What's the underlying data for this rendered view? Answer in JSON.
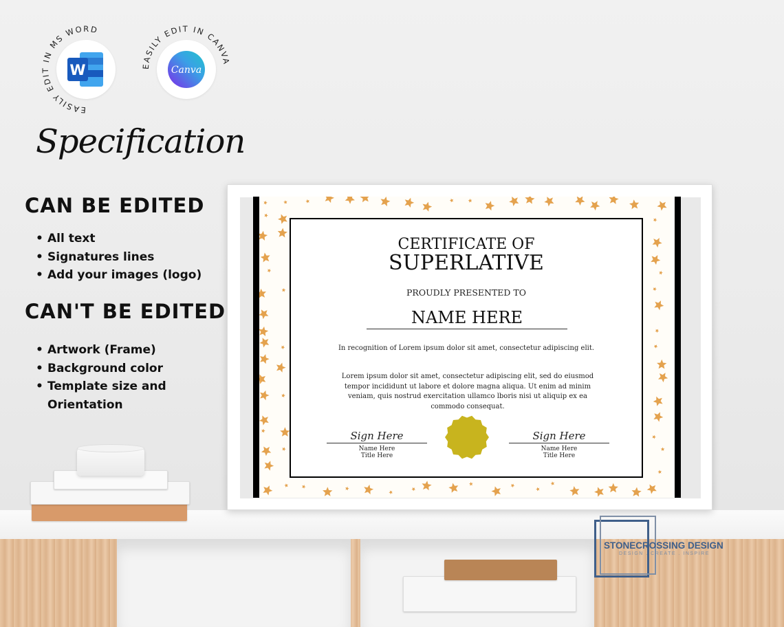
{
  "badges": [
    {
      "ring_text": "EASILY EDIT IN MS WORD",
      "icon": "ms-word-icon",
      "icon_letter": "W",
      "color": "#185abd"
    },
    {
      "ring_text": "EASILY EDIT IN CANVA",
      "icon": "canva-icon",
      "icon_letter": "Canva",
      "color": "#7d2ae8"
    }
  ],
  "spec": {
    "title": "Specification",
    "can_heading": "CAN BE EDITED",
    "can_items": [
      "All text",
      "Signatures lines",
      "Add your images (logo)"
    ],
    "cant_heading": "CAN'T BE EDITED",
    "cant_items": [
      "Artwork (Frame)",
      "Background color",
      "Template size and",
      "Orientation"
    ]
  },
  "certificate": {
    "title_line1": "CERTIFICATE OF",
    "title_line2": "SUPERLATIVE",
    "presented": "PROUDLY PRESENTED TO",
    "name": "NAME HERE",
    "recognition": "In recognition of Lorem ipsum dolor sit amet, consectetur adipiscing elit.",
    "body": "Lorem ipsum dolor sit amet, consectetur adipiscing elit, sed do eiusmod tempor incididunt ut labore et dolore magna aliqua. Ut enim ad minim veniam, quis nostrud exercitation ullamco lboris nisi ut aliquip ex ea commodo consequat.",
    "signatures": [
      {
        "sign": "Sign Here",
        "name": "Name Here",
        "title": "Title Here"
      },
      {
        "sign": "Sign Here",
        "name": "Name Here",
        "title": "Title Here"
      }
    ],
    "seal_color": "#c8b41e",
    "star_color": "#e4a24e"
  },
  "brand": {
    "name": "STONECROSSING DESIGN",
    "tagline": "DESIGN . CREATE . INSPIRE"
  }
}
